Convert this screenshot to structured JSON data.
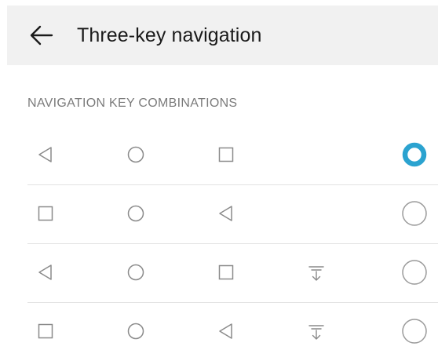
{
  "header": {
    "title": "Three-key navigation",
    "back_icon": "arrow-left-icon"
  },
  "section": {
    "title": "NAVIGATION KEY COMBINATIONS"
  },
  "colors": {
    "accent": "#2ba3d0",
    "icon": "#8a8a8a",
    "radio_border": "#9a9a9a",
    "header_bg": "#f1f1f1"
  },
  "options": [
    {
      "keys": [
        "back-icon",
        "home-icon",
        "recents-icon"
      ],
      "selected": true
    },
    {
      "keys": [
        "recents-icon",
        "home-icon",
        "back-icon"
      ],
      "selected": false
    },
    {
      "keys": [
        "back-icon",
        "home-icon",
        "recents-icon",
        "notification-pull-down-icon"
      ],
      "selected": false
    },
    {
      "keys": [
        "recents-icon",
        "home-icon",
        "back-icon",
        "notification-pull-down-icon"
      ],
      "selected": false
    }
  ]
}
